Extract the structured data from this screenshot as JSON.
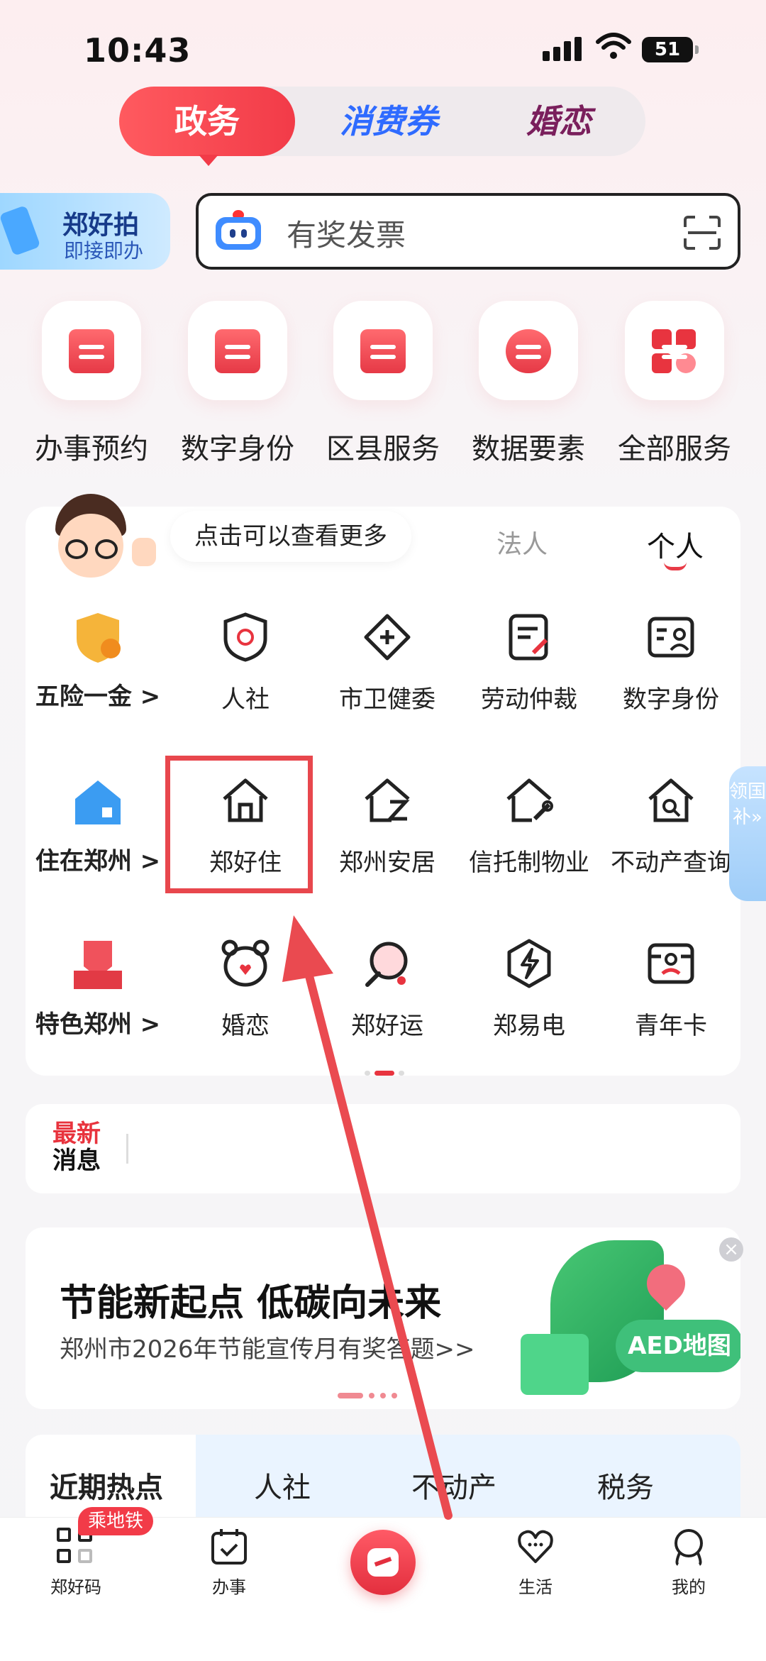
{
  "status": {
    "time": "10:43",
    "battery": "51"
  },
  "top_tabs": [
    "政务",
    "消费券",
    "婚恋"
  ],
  "promo": {
    "title": "郑好拍",
    "subtitle": "即接即办"
  },
  "search": {
    "placeholder": "有奖发票"
  },
  "quick_services": [
    "办事预约",
    "数字身份",
    "区县服务",
    "数据要素",
    "全部服务"
  ],
  "tip": "点击可以查看更多",
  "role_tabs": {
    "legal": "法人",
    "personal": "个人"
  },
  "categories": [
    "五险一金 >",
    "住在郑州 >",
    "特色郑州 >"
  ],
  "grid": [
    [
      "人社",
      "市卫健委",
      "劳动仲裁",
      "数字身份"
    ],
    [
      "郑好住",
      "郑州安居",
      "信托制物业",
      "不动产查询"
    ],
    [
      "婚恋",
      "郑好运",
      "郑易电",
      "青年卡"
    ]
  ],
  "side_tab": "领国补»",
  "news": {
    "line1": "最新",
    "line2": "消息"
  },
  "banner": {
    "title": "节能新起点 低碳向未来",
    "subtitle": "郑州市2026年节能宣传月有奖答题>>",
    "aed": "AED地图",
    "close": "×"
  },
  "hot_tabs": [
    "近期热点",
    "人社",
    "不动产",
    "税务"
  ],
  "tabbar": {
    "items": [
      "郑好码",
      "办事",
      "生活",
      "我的"
    ],
    "badge": "乘地铁"
  },
  "colors": {
    "accent": "#f23b48",
    "highlight": "#e8474d"
  }
}
